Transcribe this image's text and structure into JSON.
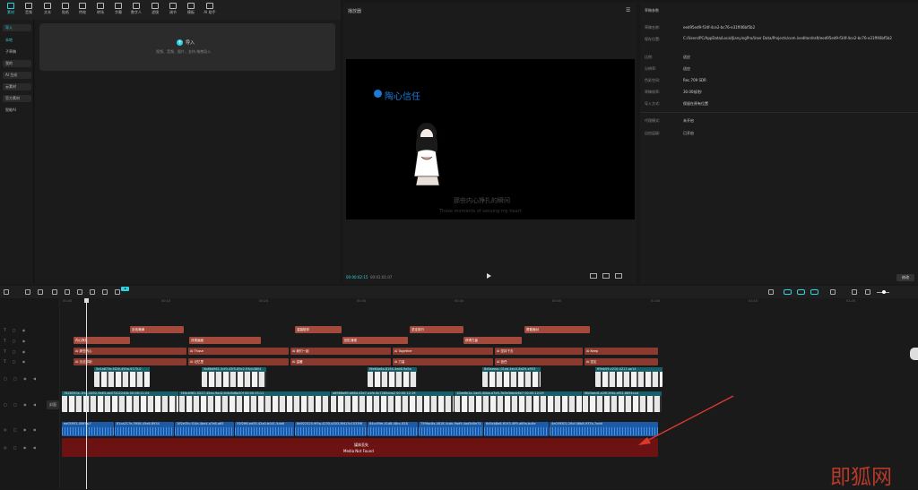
{
  "toolbar": {
    "items": [
      {
        "label": "素材",
        "icon": "media-icon"
      },
      {
        "label": "音频",
        "icon": "audio-icon"
      },
      {
        "label": "文本",
        "icon": "text-icon"
      },
      {
        "label": "贴纸",
        "icon": "sticker-icon"
      },
      {
        "label": "特效",
        "icon": "effects-icon"
      },
      {
        "label": "转场",
        "icon": "transition-icon"
      },
      {
        "label": "字幕",
        "icon": "caption-icon"
      },
      {
        "label": "数字人",
        "icon": "avatar-icon"
      },
      {
        "label": "滤镜",
        "icon": "filter-icon"
      },
      {
        "label": "调节",
        "icon": "adjust-icon"
      },
      {
        "label": "模板",
        "icon": "template-icon"
      },
      {
        "label": "AI 助手",
        "icon": "ai-icon"
      }
    ]
  },
  "sidenav": {
    "items": [
      "导入",
      "本地",
      "子草稿",
      "我的",
      "AI 生成",
      "云素材",
      "官方素材",
      "智能AI"
    ]
  },
  "import": {
    "label": "导入",
    "hint": "视频、音频、图片，支持 拖拽导入"
  },
  "player": {
    "title": "播放器",
    "brand": "陶心信任",
    "subtitle_cn": "那些内心挣扎的瞬间",
    "subtitle_en": "Those moments of sensing my heart",
    "time_current": "00:00:02:15",
    "time_total": "00:01:01:07"
  },
  "properties": {
    "title": "草稿参数",
    "rows": [
      {
        "label": "草稿名称:",
        "value": "eed95ed9-f34f-4ce2-bc76-e31ff46bf5b2"
      },
      {
        "label": "保存位置:",
        "value": "C:/Users/PC/AppData/Local/JianyingPro/User Data/Projects/com.lveditordraft/eed95ed9-f34f-4ce2-bc76-e31ff46bf5b2"
      },
      {
        "label": "比例:",
        "value": "适应"
      },
      {
        "label": "分辨率:",
        "value": "适应"
      },
      {
        "label": "色彩空间:",
        "value": "Rec.709 SDR"
      },
      {
        "label": "草稿帧率:",
        "value": "30.00帧/秒"
      },
      {
        "label": "导入方式:",
        "value": "保留在原有位置"
      },
      {
        "label": "代理模式:",
        "value": "未开启"
      },
      {
        "label": "自由层级:",
        "value": "已开启"
      }
    ],
    "modify_label": "修改"
  },
  "timeline": {
    "ruler": [
      "00:00",
      "00:10",
      "00:20",
      "00:30",
      "00:40",
      "00:50",
      "01:00",
      "01:10",
      "01:20"
    ],
    "cover_label": "封面",
    "text_row1": [
      "自信满满",
      "温馨陪伴",
      "坚定前行",
      "勇敢面对"
    ],
    "text_row2": [
      "内心挣扎",
      "浮现画面",
      "回忆涌现",
      "获得力量"
    ],
    "text_row3": [
      "AI 那些内心",
      "AI Those",
      "AI 我们一起",
      "AI Together",
      "AI 坚持下去",
      "AI Keep"
    ],
    "text_row4": [
      "AI 无法抑制",
      "AI 记忆里",
      "AI 温暖",
      "AI 力量",
      "AI 信任",
      "AI 坚定"
    ],
    "video_top": [
      "5e1a673e-f426-490a-9170-0",
      "5b86d961-5cf0-43f5-89c2-93cb3604",
      "f6e64e6a-8194-4ee8-9a5a",
      "8d0aeeac-01ad-4ec0-8d29-e953",
      "ff9eb59-c210-4217-ae14"
    ],
    "video_main": [
      "7828550e-1fa1-4452-9e83-ab57202240b  00:00:11:24",
      "f46cb961-5227-45ea-9ad2-fc8c8d6a30f  00:00:15:11",
      "a6966a69-b66d-43e7-a4fe-8c7285dda2  00:00:12:19",
      "10be6e1a-1ae5-40da-a7e5-7b5e3ebdc6e7  00:00:12:29",
      "f8b3aec8-e20f-4f4e-af52-6894cad"
    ],
    "audio": [
      "ee05953-00ff4a-f",
      "81ca217e-3956-45e8-8934",
      "1ff2e35c-f14e-4be4-a7e8-a65",
      "55f2ff6-ed55-42a0-b041-5da6",
      "8d922525-9f5a-4235-b303-8f413c1033f6",
      "84cd59e-41d8-48cc-818",
      "759fac8a-4618-4cbb-9ad9-4ad5d0e74",
      "6d5cb8e8-6193-4ff9-a89a-bc6e",
      "4e059302-26cf-46b8-937b-7edd"
    ],
    "missing_cn": "媒体丢失",
    "missing_en": "Media Not Found"
  },
  "watermark": "即狐网",
  "colors": {
    "accent": "#2fd3e0",
    "text_clip": "#a34a3c",
    "audio_clip": "#1d5aa6",
    "missing": "#6d1212",
    "arrow": "#d93a2b"
  }
}
